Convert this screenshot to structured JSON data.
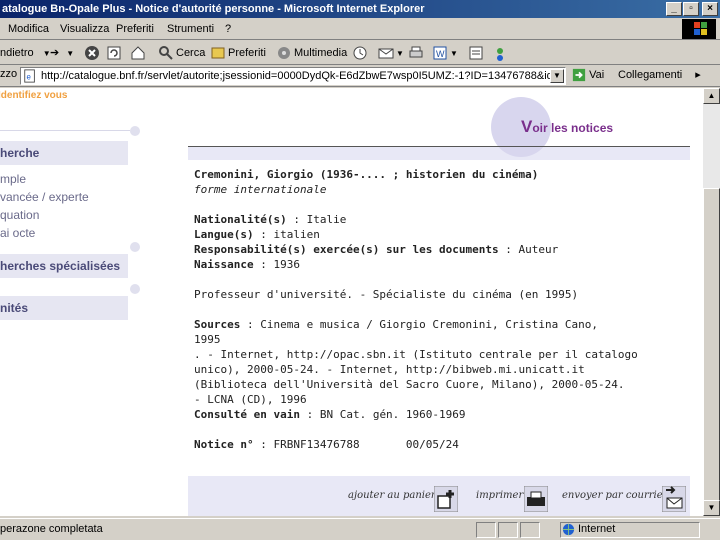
{
  "window": {
    "title": "atalogue Bn-Opale Plus - Notice d'autorité personne - Microsoft Internet Explorer",
    "min": "_",
    "max": "▫",
    "close": "×"
  },
  "menu": {
    "items": [
      "Modifica",
      "Visualizza",
      "Preferiti",
      "Strumenti",
      "?"
    ]
  },
  "toolbar": {
    "back_label": "ndietro",
    "search_label": "Cerca",
    "favorites_label": "Preferiti",
    "multimedia_label": "Multimedia"
  },
  "address": {
    "label": "zzo",
    "url": "http://catalogue.bnf.fr/servlet/autorite;jsessionid=0000DydQk-E6dZbwE7wsp0I5UMZ:-1?ID=13476788&idNoeud",
    "go_label": "Vai",
    "links_label": "Collegamenti"
  },
  "leftnav": {
    "identify": "Identifiez vous",
    "recherche": "herche",
    "links": [
      "mple",
      "vancée / experte",
      "quation",
      "ai octe"
    ],
    "specialised": "herches spécialisées",
    "unites": "nités"
  },
  "header": {
    "voir_v": "V",
    "voir_rest": "oir les notices"
  },
  "record": {
    "heading": "Cremonini, Giorgio (1936-.... ; historien du cinéma)",
    "form": "forme internationale",
    "nationalite_label": "Nationalité(s)",
    "nationalite_value": " : Italie",
    "langue_label": "Langue(s)",
    "langue_value": " : italien",
    "responsabilite_label": "Responsabilité(s) exercée(s) sur les documents",
    "responsabilite_value": " : Auteur",
    "naissance_label": "Naissance",
    "naissance_value": " : 1936",
    "note": "Professeur d'université. - Spécialiste du cinéma (en 1995)",
    "sources_label": "Sources",
    "sources_lines": [
      " : Cinema e musica / Giorgio Cremonini, Cristina Cano,",
      "1995",
      ". - Internet, http://opac.sbn.it (Istituto centrale per il catalogo",
      "unico), 2000-05-24. - Internet, http://bibweb.mi.unicatt.it",
      "(Biblioteca dell'Università del Sacro Cuore, Milano), 2000-05-24.",
      "- LCNA (CD), 1996"
    ],
    "consulte_label": "Consulté en vain",
    "consulte_value": " : BN Cat. gén. 1960-1969",
    "notice_label": "Notice n°",
    "notice_value": " : FRBNF13476788       00/05/24"
  },
  "actions": {
    "panier": "ajouter au panier",
    "imprimer": "imprimer",
    "courriel": "envoyer par courriel"
  },
  "status": {
    "text": "perazone completata",
    "zone": "Internet"
  },
  "colors": {
    "accent": "#7a2f8c",
    "nav_text": "#4a4a78",
    "orange": "#f0a040"
  }
}
